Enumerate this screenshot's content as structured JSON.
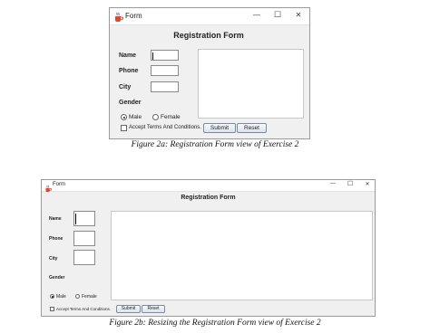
{
  "window_a": {
    "title": "Form",
    "heading": "Registration Form",
    "labels": {
      "name": "Name",
      "phone": "Phone",
      "city": "City",
      "gender": "Gender"
    },
    "fields": {
      "name": "",
      "phone": "",
      "city": ""
    },
    "gender_options": [
      "Male",
      "Female"
    ],
    "gender_selected": "Male",
    "terms_label": "Accept Terms And Conditions.",
    "terms_checked": false,
    "submit_label": "Submit",
    "reset_label": "Reset",
    "controls": {
      "minimize": "—",
      "maximize": "☐",
      "close": "✕"
    }
  },
  "caption_a": "Figure 2a: Registration Form view of Exercise 2",
  "window_b": {
    "title": "Form",
    "heading": "Registration Form",
    "labels": {
      "name": "Name",
      "phone": "Phone",
      "city": "City",
      "gender": "Gender"
    },
    "fields": {
      "name": "",
      "phone": "",
      "city": ""
    },
    "gender_options": [
      "Male",
      "Female"
    ],
    "gender_selected": "Male",
    "terms_label": "Accept Terms And Conditions.",
    "terms_checked": false,
    "submit_label": "Submit",
    "reset_label": "Reset",
    "controls": {
      "minimize": "—",
      "maximize": "☐",
      "close": "✕"
    }
  },
  "caption_b": "Figure 2b: Resizing the Registration Form view of Exercise 2",
  "icon": "java-coffee-cup-icon"
}
